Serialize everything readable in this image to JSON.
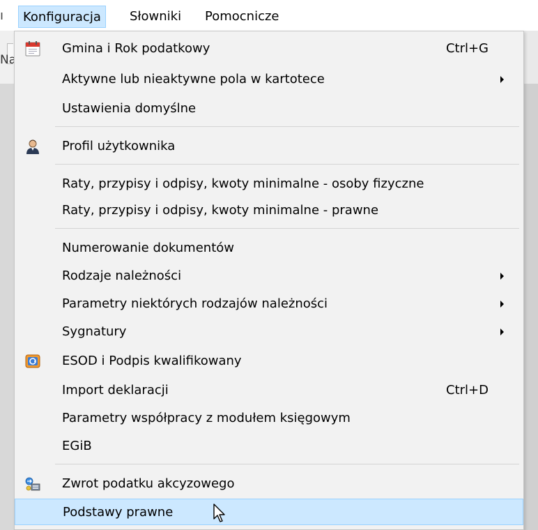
{
  "menubar": {
    "items": [
      {
        "label": "Konfiguracja",
        "active": true
      },
      {
        "label": "Słowniki",
        "active": false
      },
      {
        "label": "Pomocnicze",
        "active": false
      }
    ],
    "edge_left_char": "ı"
  },
  "background": {
    "edge_text": "Na"
  },
  "menu": {
    "items": [
      {
        "label": "Gmina i Rok podatkowy",
        "shortcut": "Ctrl+G",
        "icon": "calendar-icon"
      },
      {
        "label": "Aktywne lub nieaktywne pola w kartotece",
        "submenu": true
      },
      {
        "label": "Ustawienia domyślne"
      },
      {
        "label": "Profil użytkownika",
        "icon": "user-profile-icon"
      },
      {
        "label": "Raty, przypisy i odpisy, kwoty minimalne - osoby fizyczne"
      },
      {
        "label": "Raty, przypisy i odpisy, kwoty minimalne - prawne"
      },
      {
        "label": "Numerowanie dokumentów"
      },
      {
        "label": "Rodzaje należności",
        "submenu": true
      },
      {
        "label": "Parametry niektórych rodzajów należności",
        "submenu": true
      },
      {
        "label": "Sygnatury",
        "submenu": true
      },
      {
        "label": "ESOD i Podpis kwalifikowany",
        "icon": "esod-icon"
      },
      {
        "label": "Import deklaracji",
        "shortcut": "Ctrl+D"
      },
      {
        "label": "Parametry współpracy z modułem księgowym"
      },
      {
        "label": "EGiB"
      },
      {
        "label": "Zwrot podatku akcyzowego",
        "icon": "excise-refund-icon"
      },
      {
        "label": "Podstawy prawne",
        "highlighted": true
      }
    ]
  },
  "colors": {
    "highlight": "#cce8ff",
    "highlight_border": "#99d1ff",
    "menu_bg": "#f2f2f2",
    "separator": "#d4d4d4"
  }
}
